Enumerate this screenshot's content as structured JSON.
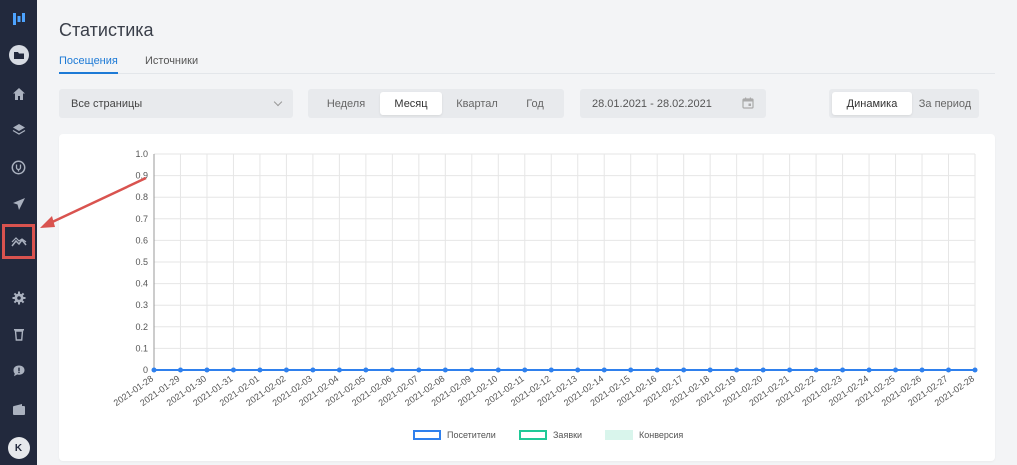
{
  "sidebar": {
    "items": [
      {
        "icon": "logo-icon"
      },
      {
        "icon": "folder-icon"
      },
      {
        "icon": "home-icon"
      },
      {
        "icon": "layers-icon"
      },
      {
        "icon": "plug-icon"
      },
      {
        "icon": "send-icon"
      },
      {
        "icon": "chart-trend-icon",
        "highlighted": true
      },
      {
        "icon": "gear-icon"
      },
      {
        "icon": "trash-icon"
      },
      {
        "icon": "chat-icon"
      },
      {
        "icon": "wallet-icon"
      }
    ],
    "avatar_letter": "K"
  },
  "header": {
    "title": "Статистика"
  },
  "tabs": [
    {
      "label": "Посещения",
      "active": true
    },
    {
      "label": "Источники",
      "active": false
    }
  ],
  "filters": {
    "page_select": "Все страницы",
    "periods": [
      {
        "label": "Неделя",
        "active": false
      },
      {
        "label": "Месяц",
        "active": true
      },
      {
        "label": "Квартал",
        "active": false
      },
      {
        "label": "Год",
        "active": false
      }
    ],
    "date_range": "28.01.2021 - 28.02.2021",
    "modes": [
      {
        "label": "Динамика",
        "active": true
      },
      {
        "label": "За период",
        "active": false
      }
    ]
  },
  "colors": {
    "accent": "#1d7ad6",
    "sidebar": "#22293d",
    "visitors": "#2f80ed",
    "requests": "#20c997",
    "conversion": "#d9f5ec",
    "highlight": "#d9534f"
  },
  "chart_data": {
    "type": "line",
    "x": [
      "2021-01-28",
      "2021-01-29",
      "2021-01-30",
      "2021-01-31",
      "2021-02-01",
      "2021-02-02",
      "2021-02-03",
      "2021-02-04",
      "2021-02-05",
      "2021-02-06",
      "2021-02-07",
      "2021-02-08",
      "2021-02-09",
      "2021-02-10",
      "2021-02-11",
      "2021-02-12",
      "2021-02-13",
      "2021-02-14",
      "2021-02-15",
      "2021-02-16",
      "2021-02-17",
      "2021-02-18",
      "2021-02-19",
      "2021-02-20",
      "2021-02-21",
      "2021-02-22",
      "2021-02-23",
      "2021-02-24",
      "2021-02-25",
      "2021-02-26",
      "2021-02-27",
      "2021-02-28"
    ],
    "y_ticks": [
      "0",
      "0.1",
      "0.2",
      "0.3",
      "0.4",
      "0.5",
      "0.6",
      "0.7",
      "0.8",
      "0.9",
      "1.0"
    ],
    "ylim": [
      0,
      1
    ],
    "series": [
      {
        "name": "Посетители",
        "values": [
          0,
          0,
          0,
          0,
          0,
          0,
          0,
          0,
          0,
          0,
          0,
          0,
          0,
          0,
          0,
          0,
          0,
          0,
          0,
          0,
          0,
          0,
          0,
          0,
          0,
          0,
          0,
          0,
          0,
          0,
          0,
          0
        ]
      },
      {
        "name": "Заявки",
        "values": [
          0,
          0,
          0,
          0,
          0,
          0,
          0,
          0,
          0,
          0,
          0,
          0,
          0,
          0,
          0,
          0,
          0,
          0,
          0,
          0,
          0,
          0,
          0,
          0,
          0,
          0,
          0,
          0,
          0,
          0,
          0,
          0
        ]
      },
      {
        "name": "Конверсия",
        "values": [
          0,
          0,
          0,
          0,
          0,
          0,
          0,
          0,
          0,
          0,
          0,
          0,
          0,
          0,
          0,
          0,
          0,
          0,
          0,
          0,
          0,
          0,
          0,
          0,
          0,
          0,
          0,
          0,
          0,
          0,
          0,
          0
        ]
      }
    ],
    "grid": true,
    "legend_position": "bottom"
  }
}
